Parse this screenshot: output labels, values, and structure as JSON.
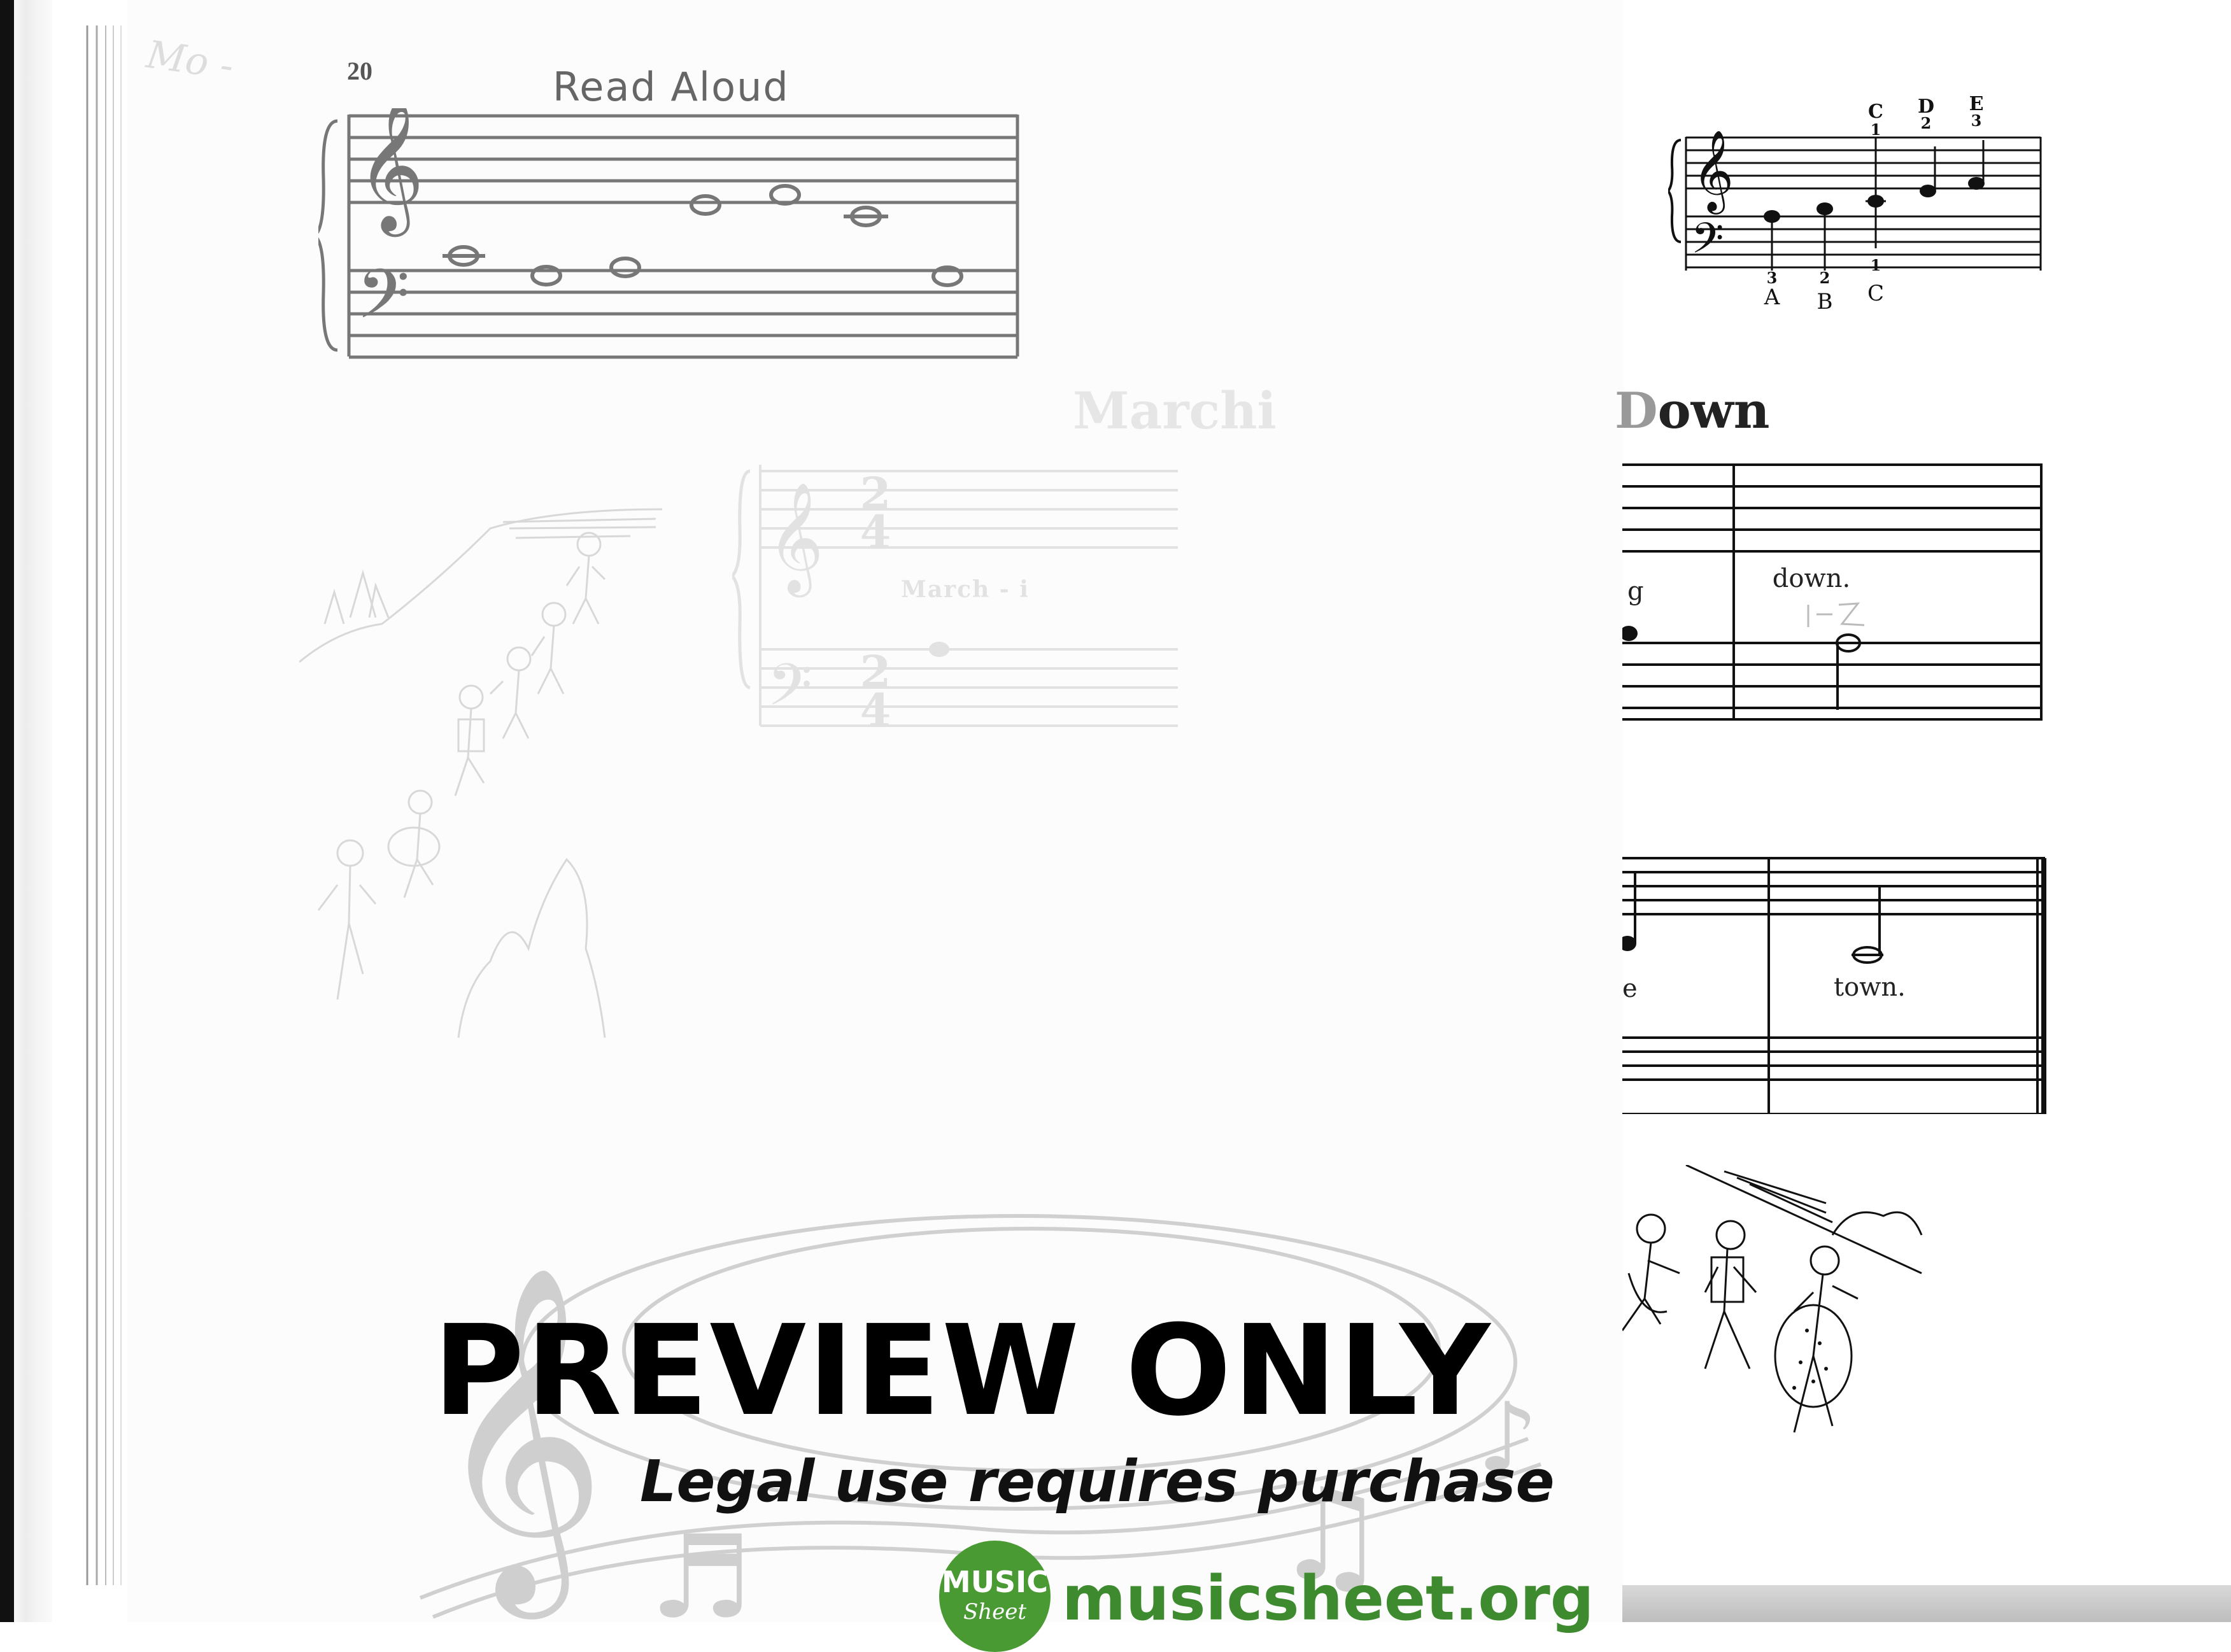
{
  "page": {
    "page_number": "20",
    "handwritten_mark": "Mo -"
  },
  "read_aloud": {
    "title": "Read Aloud"
  },
  "note_chart": {
    "top_letters": [
      "C",
      "D",
      "E"
    ],
    "top_fingers": [
      "1",
      "2",
      "3"
    ],
    "bottom_letters": [
      "A",
      "B",
      "C"
    ],
    "bottom_fingers": [
      "3",
      "2",
      "1"
    ]
  },
  "song": {
    "title_faded": "Marchi",
    "title_visible": "own",
    "faded_lyric": "March - i",
    "lyric_1": "g",
    "lyric_2": "down.",
    "lyric_3": "e",
    "lyric_4": "town.",
    "time_signature_top": "2",
    "time_signature_bottom": "4",
    "finger_pencil": "1 - 2"
  },
  "watermark": {
    "title": "PREVIEW ONLY",
    "subtitle": "Legal use requires purchase",
    "site": "musicsheet.org",
    "badge_line1": "MUSIC",
    "badge_line2": "Sheet",
    "green": "#4a9a34"
  }
}
